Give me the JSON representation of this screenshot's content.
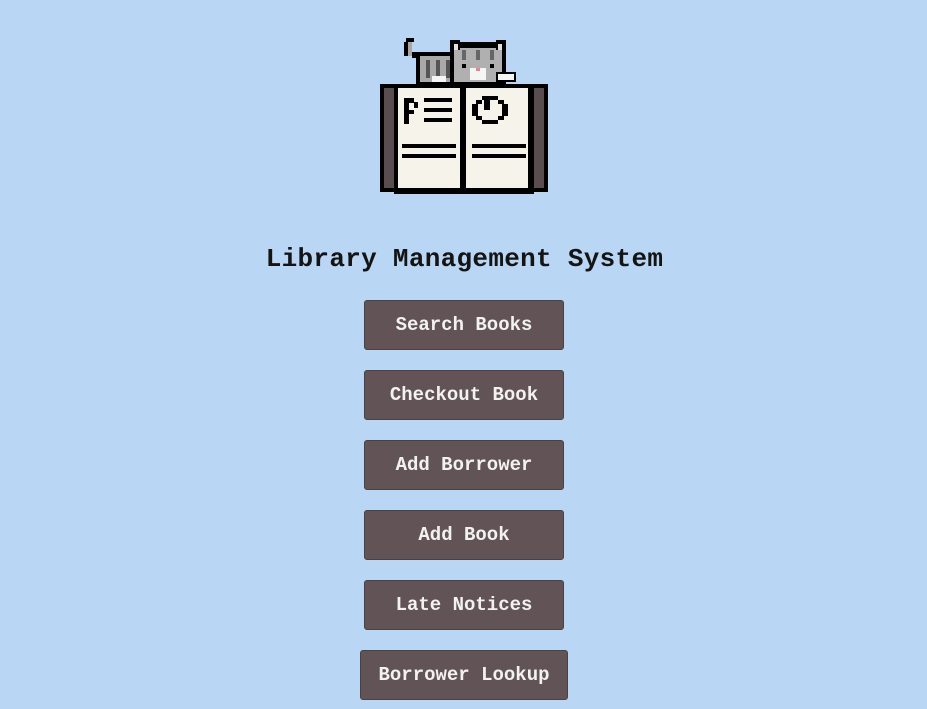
{
  "header": {
    "title": "Library Management System",
    "logo_icon": "pixel-cat-on-open-book-icon"
  },
  "menu": {
    "buttons": [
      {
        "label": "Search Books"
      },
      {
        "label": "Checkout Book"
      },
      {
        "label": "Add Borrower"
      },
      {
        "label": "Add Book"
      },
      {
        "label": "Late Notices"
      },
      {
        "label": "Borrower Lookup"
      }
    ]
  },
  "colors": {
    "background": "#b9d7f5",
    "button": "#625356",
    "button_text": "#f2f2f2",
    "title_text": "#141414"
  }
}
